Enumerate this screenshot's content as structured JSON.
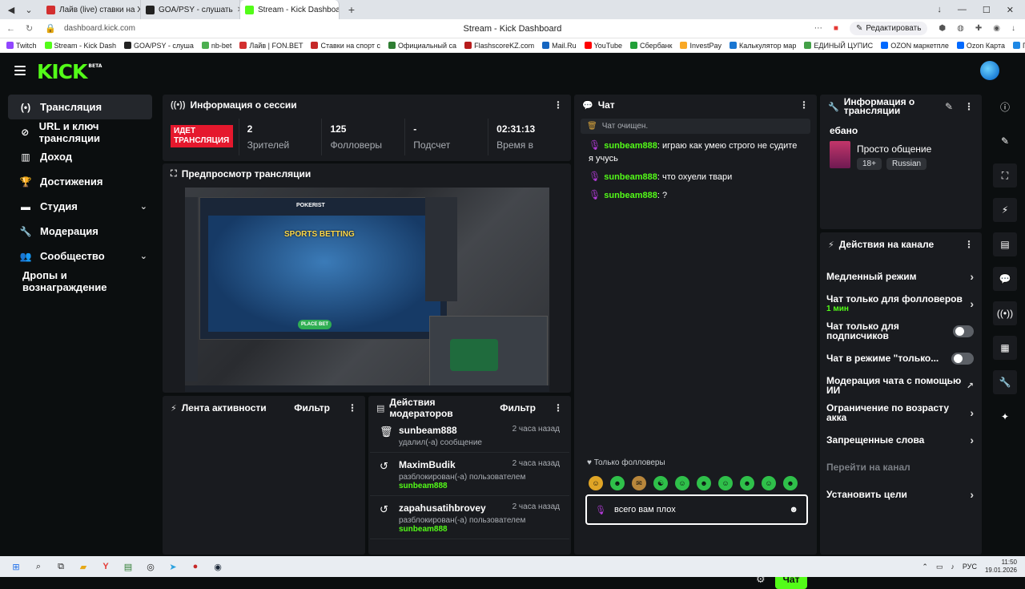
{
  "browser": {
    "tabs": [
      {
        "label": "Лайв (live) ставки на Хок",
        "color": "#d32f2f",
        "active": false
      },
      {
        "label": "GOA/PSY - слушать",
        "color": "#222222",
        "active": false
      },
      {
        "label": "Stream - Kick Dashboar",
        "color": "#53fc18",
        "active": true
      }
    ],
    "url": "dashboard.kick.com",
    "page_title": "Stream - Kick Dashboard",
    "edit_label": "Редактировать",
    "bookmarks": [
      {
        "label": "Twitch",
        "color": "#9146ff"
      },
      {
        "label": "Stream - Kick Dash",
        "color": "#53fc18"
      },
      {
        "label": "GOA/PSY - слуша",
        "color": "#222222"
      },
      {
        "label": "nb-bet",
        "color": "#4caf50"
      },
      {
        "label": "Лайв | FON.BET",
        "color": "#d32f2f"
      },
      {
        "label": "Ставки на спорт с",
        "color": "#c62828"
      },
      {
        "label": "Официальный са",
        "color": "#2e7d32"
      },
      {
        "label": "FlashscoreKZ.com",
        "color": "#b71c1c"
      },
      {
        "label": "Mail.Ru",
        "color": "#1565c0"
      },
      {
        "label": "YouTube",
        "color": "#ff0000"
      },
      {
        "label": "Сбербанк",
        "color": "#21a038"
      },
      {
        "label": "InvestPay",
        "color": "#f9a825"
      },
      {
        "label": "Калькулятор мар",
        "color": "#1976d2"
      },
      {
        "label": "ЕДИНЫЙ ЦУПИС",
        "color": "#43a047"
      },
      {
        "label": "OZON маркетпле",
        "color": "#0069ff"
      },
      {
        "label": "Ozon Карта",
        "color": "#0069ff"
      },
      {
        "label": "Госуслуги",
        "color": "#1e88e5"
      },
      {
        "label": "Ро",
        "color": "#e53935"
      }
    ]
  },
  "logo": {
    "text": "KICK",
    "badge": "BETA"
  },
  "sidebar": {
    "items": [
      {
        "label": "Трансляция",
        "icon": "(•)",
        "icon_name": "broadcast-icon",
        "active": true,
        "chevron": false
      },
      {
        "label": "URL и ключ трансляции",
        "icon": "⊘",
        "icon_name": "link-icon",
        "active": false,
        "chevron": false
      },
      {
        "label": "Доход",
        "icon": "▥",
        "icon_name": "chart-icon",
        "active": false,
        "chevron": false
      },
      {
        "label": "Достижения",
        "icon": "🏆",
        "icon_name": "trophy-icon",
        "active": false,
        "chevron": false
      },
      {
        "label": "Студия",
        "icon": "▬",
        "icon_name": "studio-icon",
        "active": false,
        "chevron": true
      },
      {
        "label": "Модерация",
        "icon": "🔧",
        "icon_name": "wrench-icon",
        "active": false,
        "chevron": false
      },
      {
        "label": "Сообщество",
        "icon": "👥",
        "icon_name": "community-icon",
        "active": false,
        "chevron": true
      },
      {
        "label": "Дропы и вознаграждение",
        "icon": "",
        "icon_name": "",
        "active": false,
        "chevron": false
      }
    ]
  },
  "session": {
    "title": "Информация о сессии",
    "live_label": "ИДЕТ ТРАНСЛЯЦИЯ",
    "stats": [
      {
        "value": "2",
        "label": "Зрителей"
      },
      {
        "value": "125",
        "label": "Фолловеры"
      },
      {
        "value": "-",
        "label": "Подсчет"
      },
      {
        "value": "02:31:13",
        "label": "Время в"
      }
    ]
  },
  "preview": {
    "title": "Предпросмотр трансляции",
    "game_title": "SPORTS BETTING",
    "place_bet": "PLACE BET",
    "brand": "POKERIST"
  },
  "activity": {
    "title": "Лента активности",
    "filter": "Фильтр"
  },
  "mod_actions": {
    "title": "Действия модераторов",
    "filter": "Фильтр",
    "items": [
      {
        "user": "sunbeam888",
        "time": "2 часа назад",
        "action": "удалил(-а) сообщение",
        "target": "",
        "icon": "🗑",
        "icon_name": "trash-icon"
      },
      {
        "user": "MaximBudik",
        "time": "2 часа назад",
        "action": "разблокирован(-а) пользователем",
        "target": "sunbeam888",
        "icon": "↺",
        "icon_name": "undo-icon"
      },
      {
        "user": "zapahusatihbrovey",
        "time": "2 часа назад",
        "action": "разблокирован(-а) пользователем",
        "target": "sunbeam888",
        "icon": "↺",
        "icon_name": "undo-icon"
      }
    ]
  },
  "chat": {
    "title": "Чат",
    "cleared": "Чат очищен.",
    "messages": [
      {
        "nick": "sunbeam888",
        "text": "играю как умею строго не судите я учусь"
      },
      {
        "nick": "sunbeam888",
        "text": "что охуели твари"
      },
      {
        "nick": "sunbeam888",
        "text": "?"
      }
    ],
    "followers_only": "Только фолловеры",
    "input_value": "всего вам плох",
    "send_label": "Чат",
    "emotes": [
      "☺",
      "☻",
      "✉",
      "☯",
      "☺",
      "☻",
      "☺",
      "☻",
      "☺",
      "☻"
    ]
  },
  "stream_info": {
    "title": "Информация о трансляции",
    "stream_title": "ебано",
    "category": "Просто общение",
    "category_img_label": "CHATTING",
    "tags": [
      "18+",
      "Russian"
    ]
  },
  "channel_actions": {
    "title": "Действия на канале",
    "items": [
      {
        "label": "Медленный режим",
        "sub": "",
        "control": "chevron"
      },
      {
        "label": "Чат только для фолловеров",
        "sub": "1 мин",
        "control": "chevron"
      },
      {
        "label": "Чат только для подписчиков",
        "sub": "",
        "control": "toggle"
      },
      {
        "label": "Чат в режиме \"только...",
        "sub": "",
        "control": "toggle"
      },
      {
        "label": "Модерация чата с помощью ИИ",
        "sub": "",
        "control": "external"
      },
      {
        "label": "Ограничение по возрасту акка",
        "sub": "",
        "control": "chevron"
      },
      {
        "label": "Запрещенные слова",
        "sub": "",
        "control": "chevron"
      },
      {
        "label": "Перейти на канал",
        "sub": "",
        "control": "none"
      },
      {
        "label": "Установить цели",
        "sub": "",
        "control": "chevron"
      }
    ]
  },
  "taskbar": {
    "time": "11:50",
    "date": "19.01.2026",
    "lang": "РУС"
  }
}
